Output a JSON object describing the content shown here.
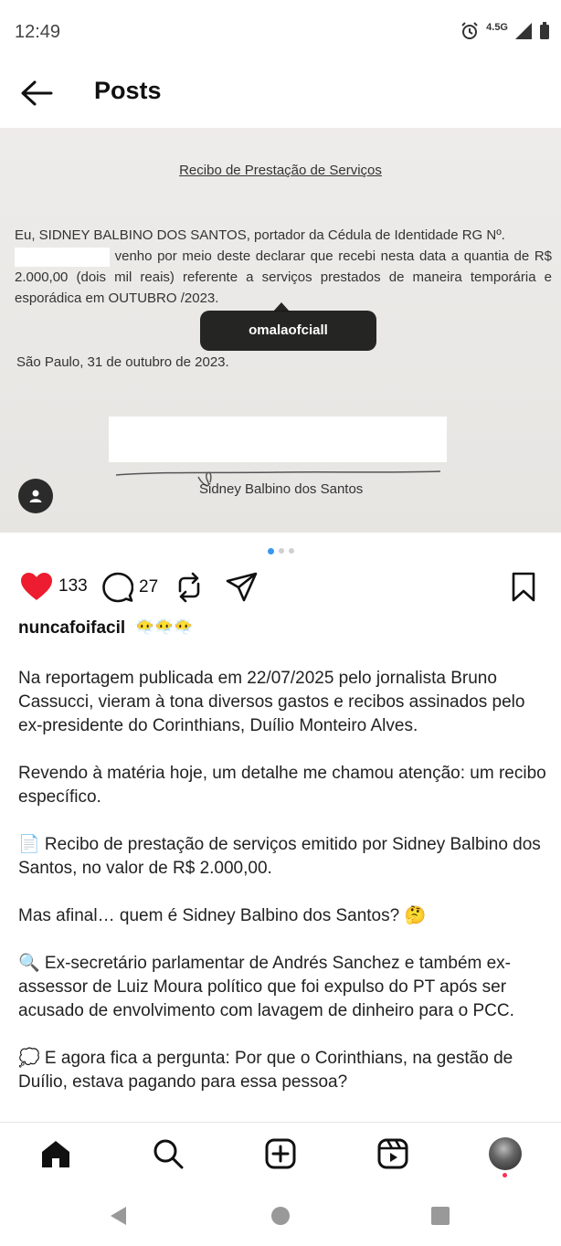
{
  "status_bar": {
    "time": "12:49",
    "network": "4.5G"
  },
  "header": {
    "title": "Posts"
  },
  "post": {
    "document": {
      "title": "Recibo de Prestação de Serviços",
      "line1": "Eu, SIDNEY BALBINO DOS SANTOS, portador da Cédula de Identidade RG Nº.",
      "line2": "venho por meio deste declarar que recebi nesta data a quantia de R$ 2.000,00 (dois mil reais) referente a serviços prestados de maneira temporária e esporádica em OUTUBRO /2023.",
      "date": "São Paulo, 31 de outubro de 2023.",
      "signer": "Sidney Balbino dos Santos"
    },
    "tag_label": "omalaofciall",
    "carousel": {
      "count": 3,
      "active": 1
    },
    "likes": "133",
    "comments": "27",
    "username": "nuncafoifacil",
    "username_emojis": "😶‍🌫️😶‍🌫️😶‍🌫️",
    "caption": [
      "Na reportagem publicada em 22/07/2025 pelo jornalista Bruno Cassucci, vieram à tona diversos gastos e recibos assinados pelo ex-presidente do Corinthians, Duílio Monteiro Alves.",
      "Revendo à matéria hoje, um detalhe me chamou atenção: um recibo específico.",
      "📄 Recibo de prestação de serviços emitido por Sidney Balbino dos Santos, no valor de R$ 2.000,00.",
      "Mas afinal… quem é Sidney Balbino dos Santos? 🤔",
      "🔍 Ex-secretário parlamentar de Andrés Sanchez e também ex-assessor de Luiz Moura político que foi expulso do PT após ser acusado de envolvimento com lavagem de dinheiro para o PCC.",
      "💭 E agora fica a pergunta: Por que o Corinthians, na gestão de Duílio, estava pagando para essa pessoa?"
    ]
  },
  "bottom_nav": {
    "items": [
      "home-icon",
      "search-icon",
      "create-icon",
      "reels-icon",
      "profile-avatar"
    ]
  },
  "system_nav": {
    "items": [
      "back",
      "home",
      "recents"
    ]
  }
}
